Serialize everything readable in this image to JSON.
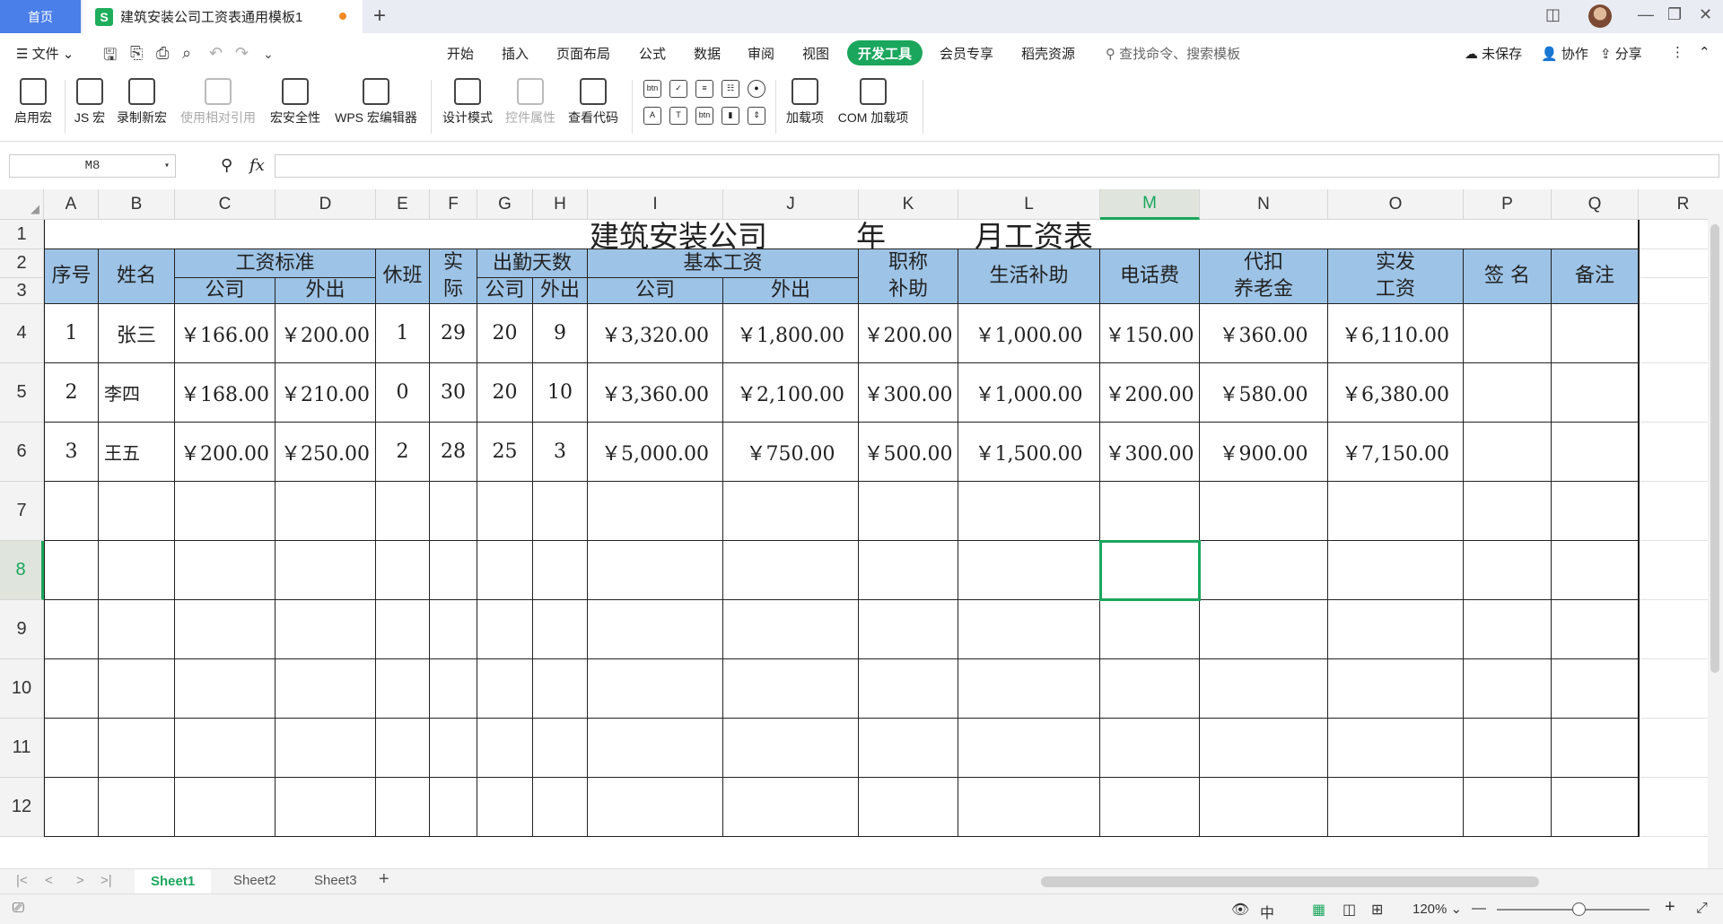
{
  "titlebar": {
    "home_tab": "首页",
    "doc_tab": "建筑安装公司工资表通用模板1",
    "logo": "S"
  },
  "menubar": {
    "file": "文件",
    "items": [
      "开始",
      "插入",
      "页面布局",
      "公式",
      "数据",
      "审阅",
      "视图"
    ],
    "active": "开发工具",
    "items2": [
      "会员专享",
      "稻壳资源"
    ],
    "search": "查找命令、搜索模板",
    "unsaved": "未保存",
    "collab": "协作",
    "share": "分享"
  },
  "ribbon": {
    "enable_macro": "启用宏",
    "js_macro": "JS 宏",
    "record_macro": "录制新宏",
    "relative_ref": "使用相对引用",
    "macro_security": "宏安全性",
    "wps_macro_editor": "WPS 宏编辑器",
    "design_mode": "设计模式",
    "control_props": "控件属性",
    "view_code": "查看代码",
    "addins": "加载项",
    "com_addins": "COM 加载项"
  },
  "formulabar": {
    "cell_ref": "M8",
    "fx": "fx"
  },
  "columns": [
    "A",
    "B",
    "C",
    "D",
    "E",
    "F",
    "G",
    "H",
    "I",
    "J",
    "K",
    "L",
    "M",
    "N",
    "O",
    "P",
    "Q",
    "R"
  ],
  "rows": [
    "1",
    "2",
    "3",
    "4",
    "5",
    "6",
    "7",
    "8",
    "9",
    "10",
    "11",
    "12"
  ],
  "sheet": {
    "title": "建筑安装公司______年______月工资表",
    "headers": {
      "seq": "序号",
      "name": "姓名",
      "wage_std": "工资标准",
      "company": "公司",
      "outside": "外出",
      "rest": "休班",
      "actual": "实\n际",
      "attendance": "出勤天数",
      "att_company": "公司",
      "att_outside": "外出",
      "base_wage": "基本工资",
      "base_company": "公司",
      "base_outside": "外出",
      "title_allow": "职称\n补助",
      "living": "生活补助",
      "phone": "电话费",
      "pension": "代扣\n养老金",
      "net_pay": "实发\n工资",
      "signature": "签    名",
      "remark": "备注"
    },
    "data": [
      [
        "1",
        "张三",
        "￥166.00",
        "￥200.00",
        "1",
        "29",
        "20",
        "9",
        "￥3,320.00",
        "￥1,800.00",
        "￥200.00",
        "￥1,000.00",
        "￥150.00",
        "￥360.00",
        "￥6,110.00",
        "",
        ""
      ],
      [
        "2",
        "李四",
        "￥168.00",
        "￥210.00",
        "0",
        "30",
        "20",
        "10",
        "￥3,360.00",
        "￥2,100.00",
        "￥300.00",
        "￥1,000.00",
        "￥200.00",
        "￥580.00",
        "￥6,380.00",
        "",
        ""
      ],
      [
        "3",
        "王五",
        "￥200.00",
        "￥250.00",
        "2",
        "28",
        "25",
        "3",
        "￥5,000.00",
        "￥750.00",
        "￥500.00",
        "￥1,500.00",
        "￥300.00",
        "￥900.00",
        "￥7,150.00",
        "",
        ""
      ]
    ]
  },
  "sheettabs": [
    "Sheet1",
    "Sheet2",
    "Sheet3"
  ],
  "statusbar": {
    "zoom": "120%"
  },
  "colors": {
    "accent": "#1aa65c",
    "header_fill": "#9dc3e6",
    "home_tab": "#4a7ee8"
  }
}
